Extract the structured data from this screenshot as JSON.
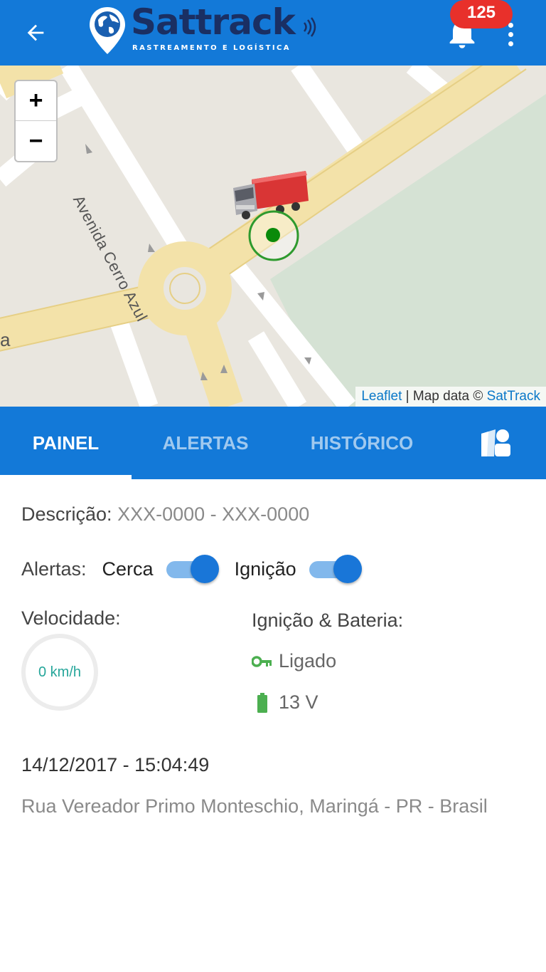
{
  "appbar": {
    "logo_title": "Sattrack",
    "logo_subtitle": "RASTREAMENTO E LOGÍSTICA",
    "notifications_count": "125",
    "icons": [
      "back-arrow-icon",
      "bell-icon",
      "more-vert-icon"
    ],
    "colors": {
      "primary": "#1379d8",
      "badge": "#e8302b"
    }
  },
  "map": {
    "zoom_in": "+",
    "zoom_out": "−",
    "street_label": "Avenida Cerro Azul",
    "street_fragment": "a",
    "attribution_leaflet": "Leaflet",
    "attribution_sep": " | Map data © ",
    "attribution_sattrack": "SatTrack",
    "marker_icon": "truck-icon"
  },
  "tabs": {
    "items": [
      "PAINEL",
      "ALERTAS",
      "HISTÓRICO"
    ],
    "active": "PAINEL",
    "extra_icon": "user-map-icon"
  },
  "panel": {
    "description_label": "Descrição:",
    "description_value": "XXX-0000 - XXX-0000",
    "alerts_label": "Alertas:",
    "alert_fence_label": "Cerca",
    "alert_fence_on": true,
    "alert_ignition_label": "Ignição",
    "alert_ignition_on": true,
    "speed_label": "Velocidade:",
    "speed_value": "0 km/h",
    "ignition_battery_label": "Ignição & Bateria:",
    "ignition_status": "Ligado",
    "battery_voltage": "13 V",
    "datetime": "14/12/2017 - 15:04:49",
    "address": "Rua Vereador Primo Monteschio, Maringá - PR - Brasil",
    "status_color": "#4caf50"
  }
}
